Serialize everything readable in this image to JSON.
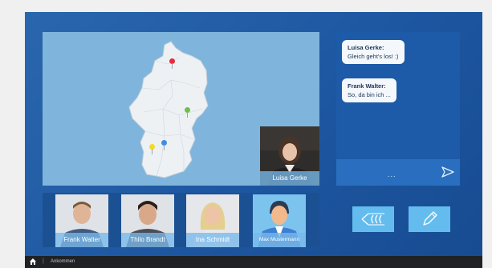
{
  "map": {
    "pins": [
      {
        "color": "#e42c3b",
        "region": "Hamburg"
      },
      {
        "color": "#6cc04a",
        "region": "Hessen"
      },
      {
        "color": "#f1da2a",
        "region": "Baden-Württemberg"
      },
      {
        "color": "#3d8fe0",
        "region": "Baden-Württemberg"
      }
    ]
  },
  "presenter": {
    "name": "Luisa Gerke"
  },
  "chat": {
    "messages": [
      {
        "sender": "Luisa Gerke:",
        "text": "Gleich geht's los! :)"
      },
      {
        "sender": "Frank Walter:",
        "text": "So, da bin ich ..."
      }
    ],
    "input_placeholder": "...",
    "send_icon": "send-arrow-icon"
  },
  "participants": [
    {
      "name": "Frank Walter"
    },
    {
      "name": "Thilo Brandt"
    },
    {
      "name": "Ina Schmidt"
    },
    {
      "name": "Max Mustermann"
    }
  ],
  "actions": {
    "back_icon": "back-arrows-icon",
    "edit_icon": "pencil-icon"
  },
  "footer": {
    "home_icon": "home-icon",
    "separator": "|",
    "breadcrumb": "Ankommen"
  },
  "colors": {
    "background": "#1e58a2",
    "map_water": "#7fb5dc",
    "chat_panel": "#1d5aa7",
    "button": "#64bcee",
    "footer": "#1f2125"
  }
}
